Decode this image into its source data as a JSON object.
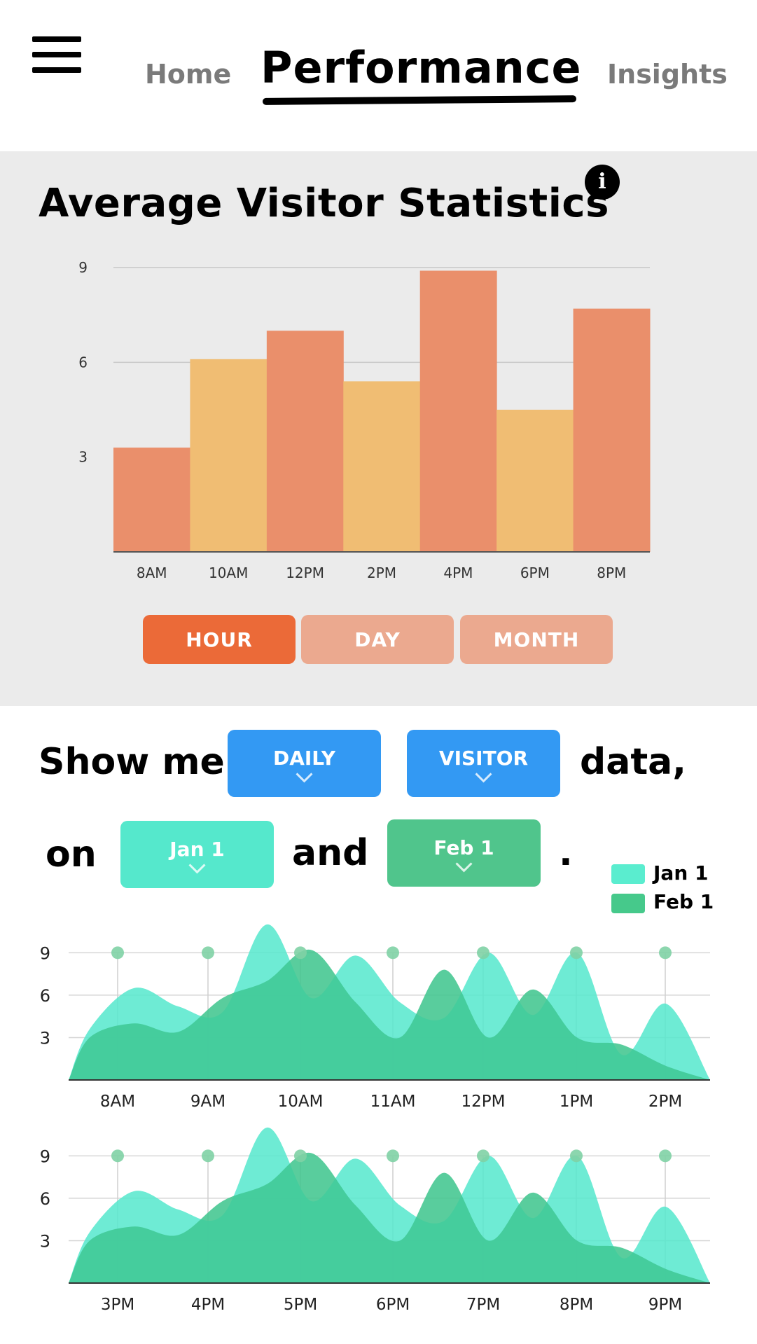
{
  "nav": {
    "home_label": "Home",
    "active_label": "Performance",
    "insights_label": "Insights"
  },
  "stats": {
    "title": "Average Visitor Statistics",
    "info_glyph": "i",
    "tabs": [
      {
        "label": "HOUR",
        "active": true
      },
      {
        "label": "DAY",
        "active": false
      },
      {
        "label": "MONTH",
        "active": false
      }
    ]
  },
  "query": {
    "show_me": "Show me",
    "period_value": "DAILY",
    "metric_value": "VISITOR",
    "data_word": "data,",
    "on_word": "on",
    "date_a": "Jan 1",
    "and_word": "and",
    "date_b": "Feb 1",
    "period_end": "."
  },
  "legend": [
    {
      "label": "Jan 1",
      "color": "#5aedcf"
    },
    {
      "label": "Feb 1",
      "color": "#46c98b"
    }
  ],
  "colors": {
    "bar_orange": "#ea8f6b",
    "bar_yellow": "#f0bd73",
    "tab_active": "#eb6a38",
    "tab_inactive": "#eba98f",
    "blue": "#3399f3",
    "teal": "#55e8cc",
    "green": "#50c58c"
  },
  "chart_data": [
    {
      "type": "bar",
      "categories": [
        "8AM",
        "10AM",
        "12PM",
        "2PM",
        "4PM",
        "6PM",
        "8PM"
      ],
      "values": [
        3.3,
        6.1,
        7.0,
        5.4,
        8.9,
        4.5,
        7.7
      ],
      "title": "",
      "yticks": [
        3,
        6,
        9
      ],
      "ylim": [
        0,
        9
      ],
      "grid": true
    },
    {
      "type": "area",
      "x": [
        "8AM",
        "9AM",
        "10AM",
        "11AM",
        "12PM",
        "1PM",
        "2PM"
      ],
      "yticks": [
        3,
        6,
        9
      ],
      "ylim": [
        0,
        11
      ],
      "grid": true,
      "series": [
        {
          "name": "Jan 1",
          "values": [
            3.6,
            6.5,
            5.2,
            4.8,
            11.0,
            5.8,
            8.8,
            5.5,
            4.4,
            9.0,
            4.6,
            9.0,
            1.8,
            5.4,
            0.0
          ]
        },
        {
          "name": "Feb 1",
          "values": [
            3.0,
            4.0,
            3.4,
            5.8,
            7.0,
            9.2,
            5.5,
            3.0,
            7.8,
            3.0,
            6.4,
            3.0,
            2.5,
            1.0,
            0.0
          ]
        }
      ]
    },
    {
      "type": "area",
      "x": [
        "3PM",
        "4PM",
        "5PM",
        "6PM",
        "7PM",
        "8PM",
        "9PM"
      ],
      "yticks": [
        3,
        6,
        9
      ],
      "ylim": [
        0,
        11
      ],
      "grid": true,
      "series": [
        {
          "name": "Jan 1",
          "values": [
            3.6,
            6.5,
            5.2,
            4.8,
            11.0,
            5.8,
            8.8,
            5.5,
            4.4,
            9.0,
            4.6,
            9.0,
            1.8,
            5.4,
            0.0
          ]
        },
        {
          "name": "Feb 1",
          "values": [
            3.0,
            4.0,
            3.4,
            5.8,
            7.0,
            9.2,
            5.5,
            3.0,
            7.8,
            3.0,
            6.4,
            3.0,
            2.5,
            1.0,
            0.0
          ]
        }
      ]
    }
  ]
}
